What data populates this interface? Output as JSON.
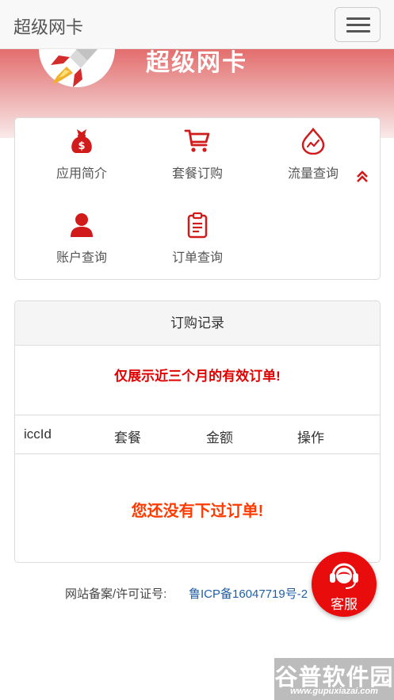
{
  "navbar": {
    "brand": "超级网卡",
    "menu_toggle_icon": "hamburger-icon"
  },
  "banner": {
    "title": "超级网卡",
    "logo_icon": "rocket-icon",
    "gradient_top": "#e36d6d",
    "gradient_bottom": "#fbeaea"
  },
  "menu": {
    "items": [
      {
        "label": "应用简介",
        "icon": "money-bag-icon"
      },
      {
        "label": "套餐订购",
        "icon": "shopping-cart-icon"
      },
      {
        "label": "流量查询",
        "icon": "traffic-drop-icon"
      },
      {
        "label": "账户查询",
        "icon": "user-icon"
      },
      {
        "label": "订单查询",
        "icon": "clipboard-icon"
      }
    ],
    "collapse_icon": "double-chevron-up-icon",
    "icon_color": "#d11a1a"
  },
  "orders": {
    "title": "订购记录",
    "notice": "仅展示近三个月的有效订单!",
    "columns": [
      "iccId",
      "套餐",
      "金额",
      "操作"
    ],
    "empty_text": "您还没有下过订单!"
  },
  "footer": {
    "record_label": "网站备案/许可证号:",
    "record_link": "鲁ICP备16047719号-2"
  },
  "customer_service": {
    "label": "客服",
    "icon": "headset-icon",
    "color": "#e80c0c"
  },
  "watermark": {
    "title": "谷普软件园",
    "url": "www.gupuxiazai.com"
  }
}
